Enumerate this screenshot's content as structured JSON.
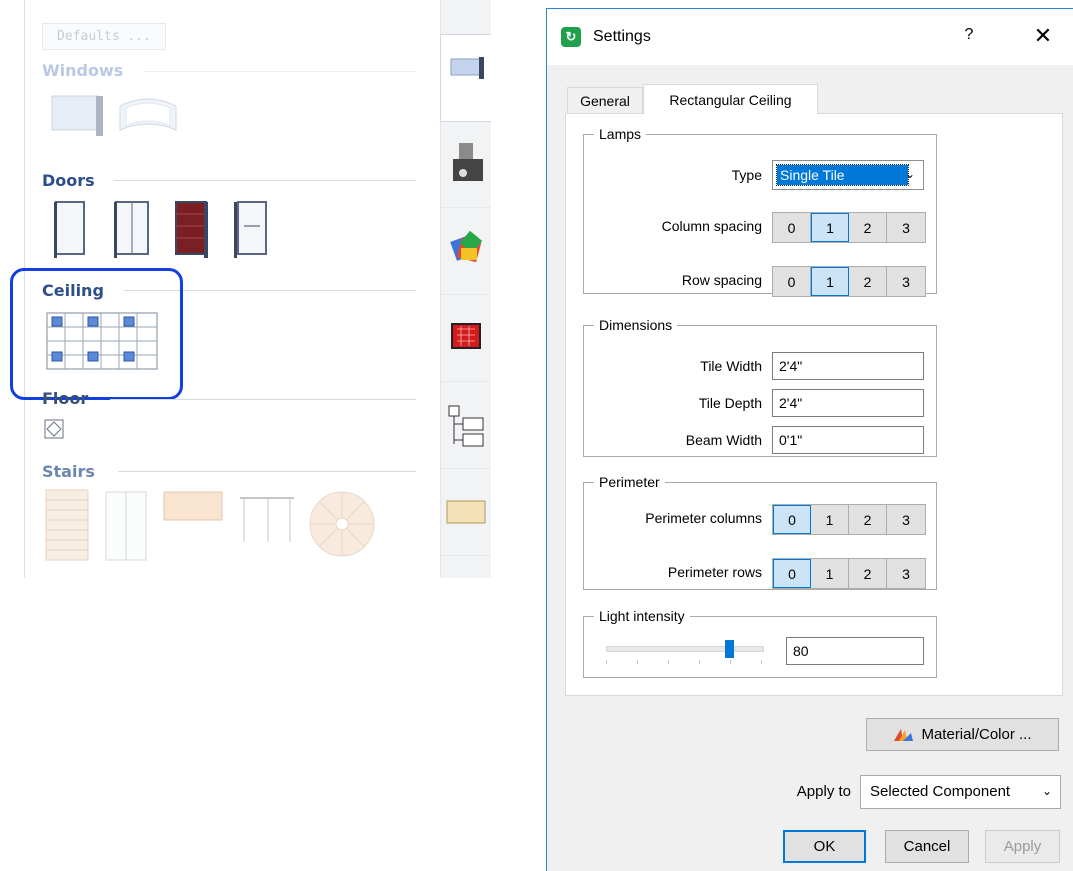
{
  "library": {
    "defaults_button": "Defaults ...",
    "categories": {
      "windows": "Windows",
      "doors": "Doors",
      "ceiling": "Ceiling",
      "floor": "Floor",
      "stairs": "Stairs"
    },
    "side_tabs": [
      "windows-doors-icon",
      "camera-icon",
      "materials-icon",
      "planner-icon",
      "hierarchy-icon",
      "tile-icon"
    ],
    "highlight_color": "#1240e0"
  },
  "dialog": {
    "title": "Settings",
    "help": "?",
    "close": "✕",
    "tabs": {
      "general": "General",
      "rectangular_ceiling": "Rectangular Ceiling"
    },
    "lamps": {
      "legend": "Lamps",
      "type_label": "Type",
      "type_value": "Single Tile",
      "column_spacing_label": "Column spacing",
      "row_spacing_label": "Row spacing",
      "options": [
        "0",
        "1",
        "2",
        "3"
      ],
      "column_spacing_selected": "1",
      "row_spacing_selected": "1"
    },
    "dimensions": {
      "legend": "Dimensions",
      "tile_width_label": "Tile Width",
      "tile_width_value": "2'4\"",
      "tile_depth_label": "Tile Depth",
      "tile_depth_value": "2'4\"",
      "beam_width_label": "Beam Width",
      "beam_width_value": "0'1\""
    },
    "perimeter": {
      "legend": "Perimeter",
      "columns_label": "Perimeter columns",
      "rows_label": "Perimeter rows",
      "options": [
        "0",
        "1",
        "2",
        "3"
      ],
      "columns_selected": "0",
      "rows_selected": "0"
    },
    "light": {
      "legend": "Light intensity",
      "value": "80",
      "slider_level": 0.8
    },
    "material_button": "Material/Color ...",
    "apply_to_label": "Apply to",
    "apply_to_value": "Selected Component",
    "ok": "OK",
    "cancel": "Cancel",
    "apply": "Apply"
  }
}
